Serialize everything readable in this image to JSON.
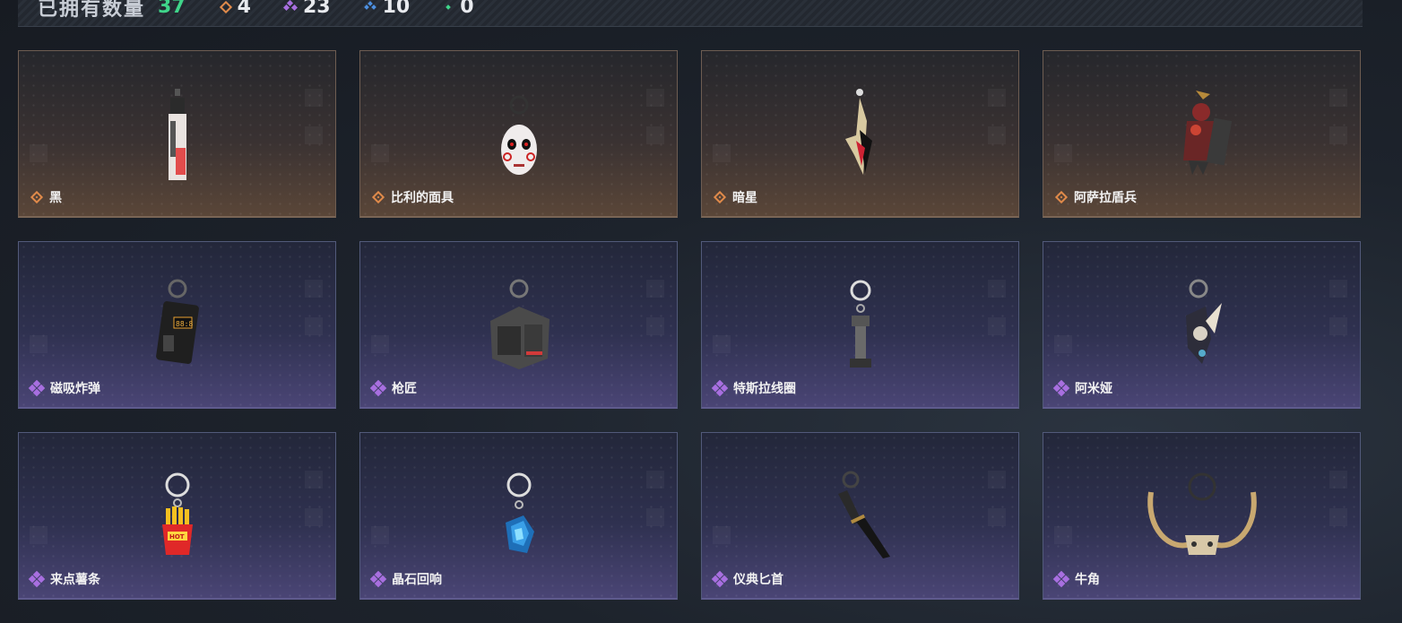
{
  "header": {
    "owned_label": "已拥有数量",
    "owned_total": "37",
    "counts": [
      {
        "icon": "gold-diamond-icon",
        "value": "4",
        "color": "#e08a4a"
      },
      {
        "icon": "purple-gem-icon",
        "value": "23",
        "color": "#a86fe0"
      },
      {
        "icon": "blue-gem-icon",
        "value": "10",
        "color": "#4c8fe0"
      },
      {
        "icon": "green-gem-icon",
        "value": "0",
        "color": "#3fd58a"
      }
    ]
  },
  "items": [
    {
      "name": "黑",
      "rarity": "gold"
    },
    {
      "name": "比利的面具",
      "rarity": "gold"
    },
    {
      "name": "暗星",
      "rarity": "gold"
    },
    {
      "name": "阿萨拉盾兵",
      "rarity": "gold"
    },
    {
      "name": "磁吸炸弹",
      "rarity": "purple"
    },
    {
      "name": "枪匠",
      "rarity": "purple"
    },
    {
      "name": "特斯拉线圈",
      "rarity": "purple"
    },
    {
      "name": "阿米娅",
      "rarity": "purple"
    },
    {
      "name": "来点薯条",
      "rarity": "purple"
    },
    {
      "name": "晶石回响",
      "rarity": "purple"
    },
    {
      "name": "仪典匕首",
      "rarity": "purple"
    },
    {
      "name": "牛角",
      "rarity": "purple"
    }
  ]
}
